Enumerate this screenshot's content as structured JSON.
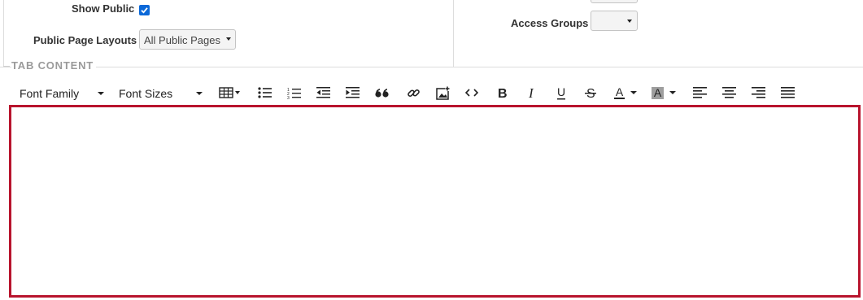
{
  "form": {
    "show_public_label": "Show Public",
    "show_public_checked": true,
    "public_page_layouts_label": "Public Page Layouts",
    "public_page_layouts_value": "All Public Pages",
    "access_groups_label": "Access Groups",
    "access_groups_value": ""
  },
  "tab_content": {
    "section_title": "TAB CONTENT"
  },
  "toolbar": {
    "font_family_label": "Font Family",
    "font_sizes_label": "Font Sizes",
    "text_color_letter": "A",
    "bg_color_letter": "A",
    "buttons": [
      "table-icon",
      "bullet-list-icon",
      "numbered-list-icon",
      "outdent-icon",
      "indent-icon",
      "blockquote-icon",
      "link-icon",
      "image-icon",
      "code-icon",
      "bold-icon",
      "italic-icon",
      "underline-icon",
      "strikethrough-icon",
      "text-color-icon",
      "background-color-icon",
      "align-left-icon",
      "align-center-icon",
      "align-right-icon",
      "align-justify-icon"
    ]
  },
  "colors": {
    "editor_border": "#b8142d",
    "checkbox": "#0b68d8",
    "section_title": "#9a9a9a"
  },
  "editor": {
    "content": ""
  }
}
